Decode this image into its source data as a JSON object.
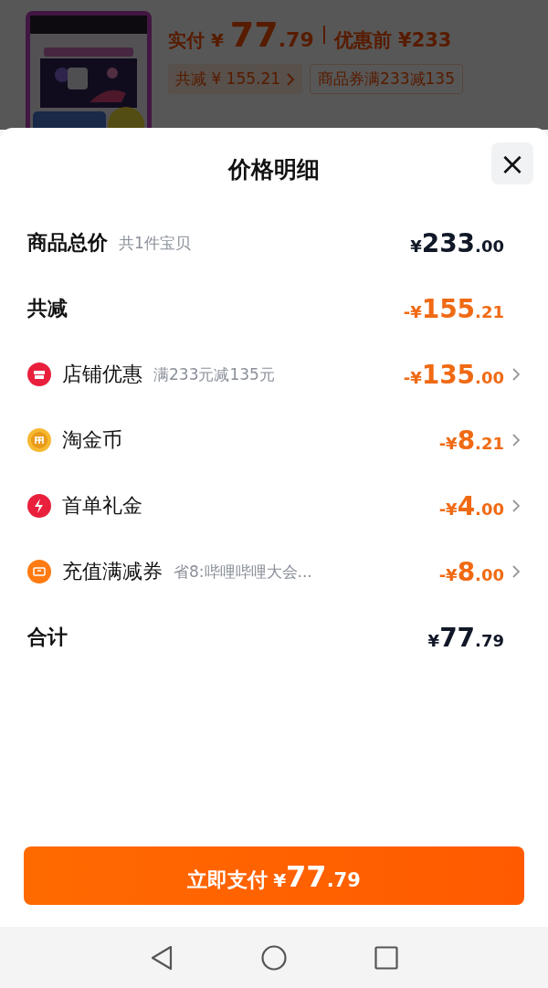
{
  "product": {
    "paid_label": "实付",
    "paid_currency": "¥",
    "paid_whole": "77",
    "paid_fraction": ".79",
    "original_price": "优惠前 ¥233",
    "tags": [
      {
        "text": "共减 ¥ 155.21",
        "chevron": true
      },
      {
        "text": "商品券满233减135",
        "chevron": false
      }
    ]
  },
  "sheet": {
    "title": "价格明细",
    "close": "×",
    "rows": [
      {
        "kind": "total",
        "label": "商品总价",
        "note": "共1件宝贝",
        "prefix": "¥",
        "whole": "233",
        "fraction": ".00",
        "chevron": false
      },
      {
        "kind": "reduction",
        "label": "共减",
        "prefix": "-¥",
        "whole": "155",
        "fraction": ".21",
        "chevron": false
      },
      {
        "kind": "discount",
        "label": "店铺优惠",
        "note": "满233元减135元",
        "prefix": "-¥",
        "whole": "135",
        "fraction": ".00",
        "chevron": true
      },
      {
        "kind": "discount",
        "label": "淘金币",
        "prefix": "-¥",
        "whole": "8",
        "fraction": ".21",
        "chevron": true
      },
      {
        "kind": "discount",
        "label": "首单礼金",
        "prefix": "-¥",
        "whole": "4",
        "fraction": ".00",
        "chevron": true
      },
      {
        "kind": "discount",
        "label": "充值满减券",
        "note": "省8:哔哩哔哩大会...",
        "prefix": "-¥",
        "whole": "8",
        "fraction": ".00",
        "chevron": true
      },
      {
        "kind": "total",
        "label": "合计",
        "prefix": "¥",
        "whole": "77",
        "fraction": ".79",
        "chevron": false
      }
    ],
    "pay_button": {
      "label": "立即支付",
      "currency": "¥",
      "whole": "77",
      "fraction": ".79"
    }
  }
}
